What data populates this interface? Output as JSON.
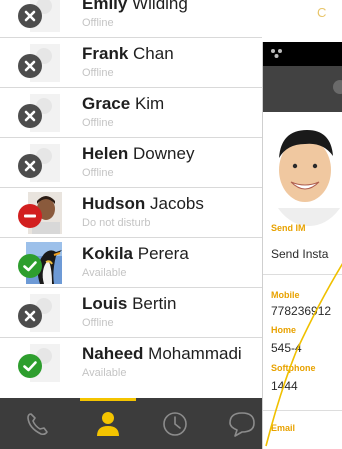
{
  "contacts": [
    {
      "first": "Emily",
      "last": "Wilding",
      "status": "Offline",
      "presence": "offline",
      "avatar": "silhouette"
    },
    {
      "first": "Frank",
      "last": "Chan",
      "status": "Offline",
      "presence": "offline",
      "avatar": "silhouette"
    },
    {
      "first": "Grace",
      "last": "Kim",
      "status": "Offline",
      "presence": "offline",
      "avatar": "silhouette"
    },
    {
      "first": "Helen",
      "last": "Downey",
      "status": "Offline",
      "presence": "offline",
      "avatar": "silhouette"
    },
    {
      "first": "Hudson",
      "last": "Jacobs",
      "status": "Do not disturb",
      "presence": "dnd",
      "avatar": "photo-man"
    },
    {
      "first": "Kokila",
      "last": "Perera",
      "status": "Available",
      "presence": "available",
      "avatar": "photo-penguin"
    },
    {
      "first": "Louis",
      "last": "Bertin",
      "status": "Offline",
      "presence": "offline",
      "avatar": "silhouette"
    },
    {
      "first": "Naheed",
      "last": "Mohammadi",
      "status": "Available",
      "presence": "available",
      "avatar": "silhouette"
    }
  ],
  "bottom_nav": {
    "items": [
      {
        "name": "phone-icon",
        "active": false
      },
      {
        "name": "contacts-icon",
        "active": true
      },
      {
        "name": "history-clock-icon",
        "active": false
      },
      {
        "name": "chat-bubble-icon",
        "active": false
      }
    ]
  },
  "detail": {
    "top_fragment": "C",
    "send_im_label": "Send IM",
    "send_im_value": "Send Insta",
    "mobile_label": "Mobile",
    "mobile_value": "778236912",
    "home_label": "Home",
    "home_value": "545-4",
    "softphone_label": "Softphone",
    "softphone_value": "1444",
    "email_label": "Email"
  },
  "colors": {
    "accent": "#f4c400",
    "label_orange": "#e8a200",
    "offline": "#4d4d4d",
    "available": "#2e9e2e",
    "dnd": "#d21f1f",
    "nav_bg": "#3c3c3c"
  }
}
